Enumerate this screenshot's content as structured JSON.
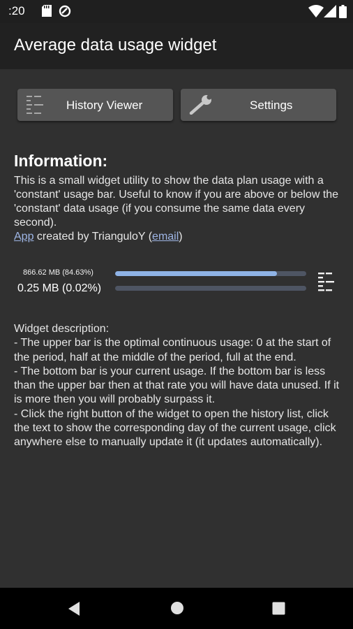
{
  "status_bar": {
    "time": ":20",
    "icons": [
      "sd-card-icon",
      "data-saver-icon",
      "wifi-icon",
      "signal-icon",
      "battery-icon"
    ]
  },
  "app_bar": {
    "title": "Average data usage widget"
  },
  "buttons": {
    "history_label": "History Viewer",
    "settings_label": "Settings"
  },
  "info": {
    "heading": "Information:",
    "text": "This is a small widget utility to show the data plan usage with a 'constant' usage bar. Useful to know if you are above or below the 'constant' data usage (if you consume the same data every second).",
    "app_link": "App",
    "created_by": " created by TrianguloY (",
    "email_link": "email",
    "close_paren": ")"
  },
  "widget": {
    "top_text": "866.62 MB (84.63%)",
    "bottom_text": "0.25 MB (0.02%)",
    "top_fill_fraction": 0.8463,
    "bottom_fill_fraction": 0.0002
  },
  "description": {
    "title": "Widget description:",
    "items": [
      "- The upper bar is the optimal continuous usage: 0 at the start of the period, half at the middle of the period, full at the end.",
      "- The bottom bar is your current usage. If the bottom bar is less than the upper bar then at that rate you will have data unused. If it is more then you will probably surpass it.",
      "- Click the right button of the widget to open the history list, click the text to show the corresponding day of the current usage, click anywhere else to manually update it (it updates automatically)."
    ]
  },
  "nav": {
    "icons": [
      "back-icon",
      "home-icon",
      "recents-icon"
    ]
  },
  "colors": {
    "background": "#303030",
    "app_bar": "#212121",
    "button": "#555555",
    "bar_fill": "#8fb3e6",
    "bar_track": "#4e5563",
    "link": "#9fb6e6"
  }
}
